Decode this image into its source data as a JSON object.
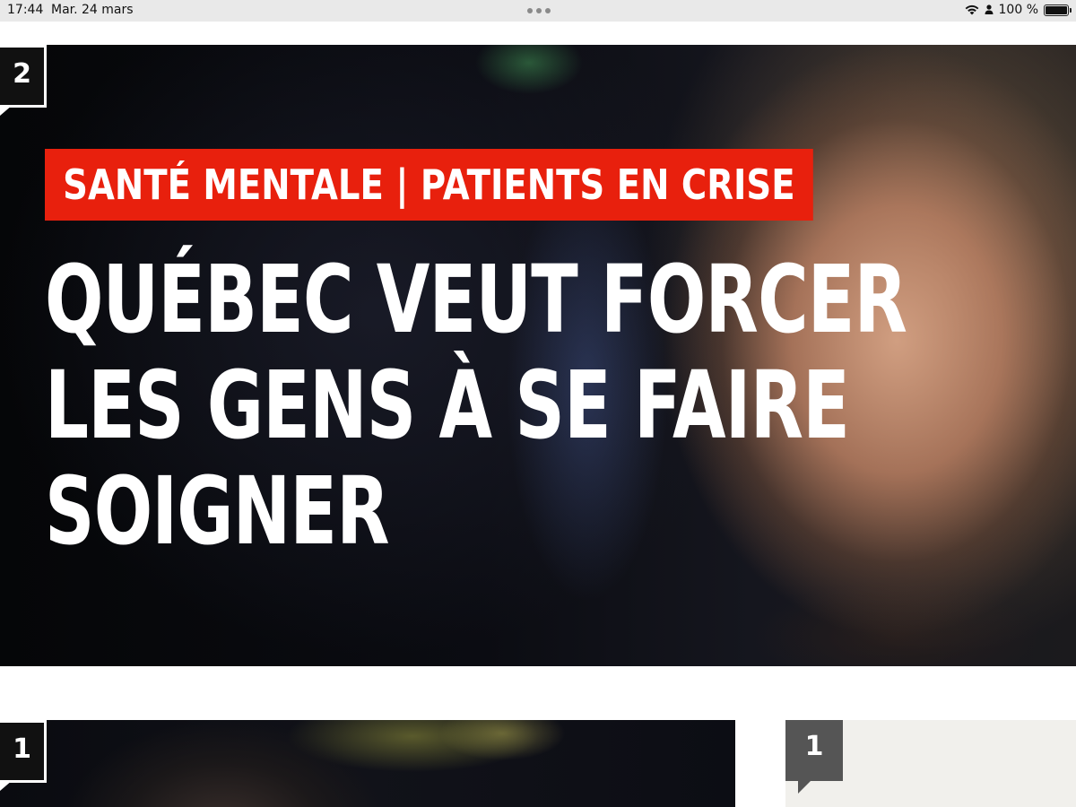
{
  "status_bar": {
    "time": "17:44",
    "date": "Mar. 24 mars",
    "battery_label": "100 %",
    "wifi_icon": "wifi-icon",
    "user_icon": "person-icon",
    "battery_icon": "battery-full-icon"
  },
  "hero": {
    "rank": "2",
    "kicker": "SANTÉ MENTALE | PATIENTS EN CRISE",
    "headline_lines": [
      "QUÉBEC VEUT FORCER",
      "LES GENS À SE FAIRE",
      "SOIGNER"
    ],
    "kicker_color": "#e8200d"
  },
  "cards": [
    {
      "rank": "1"
    },
    {
      "rank": "1"
    }
  ]
}
